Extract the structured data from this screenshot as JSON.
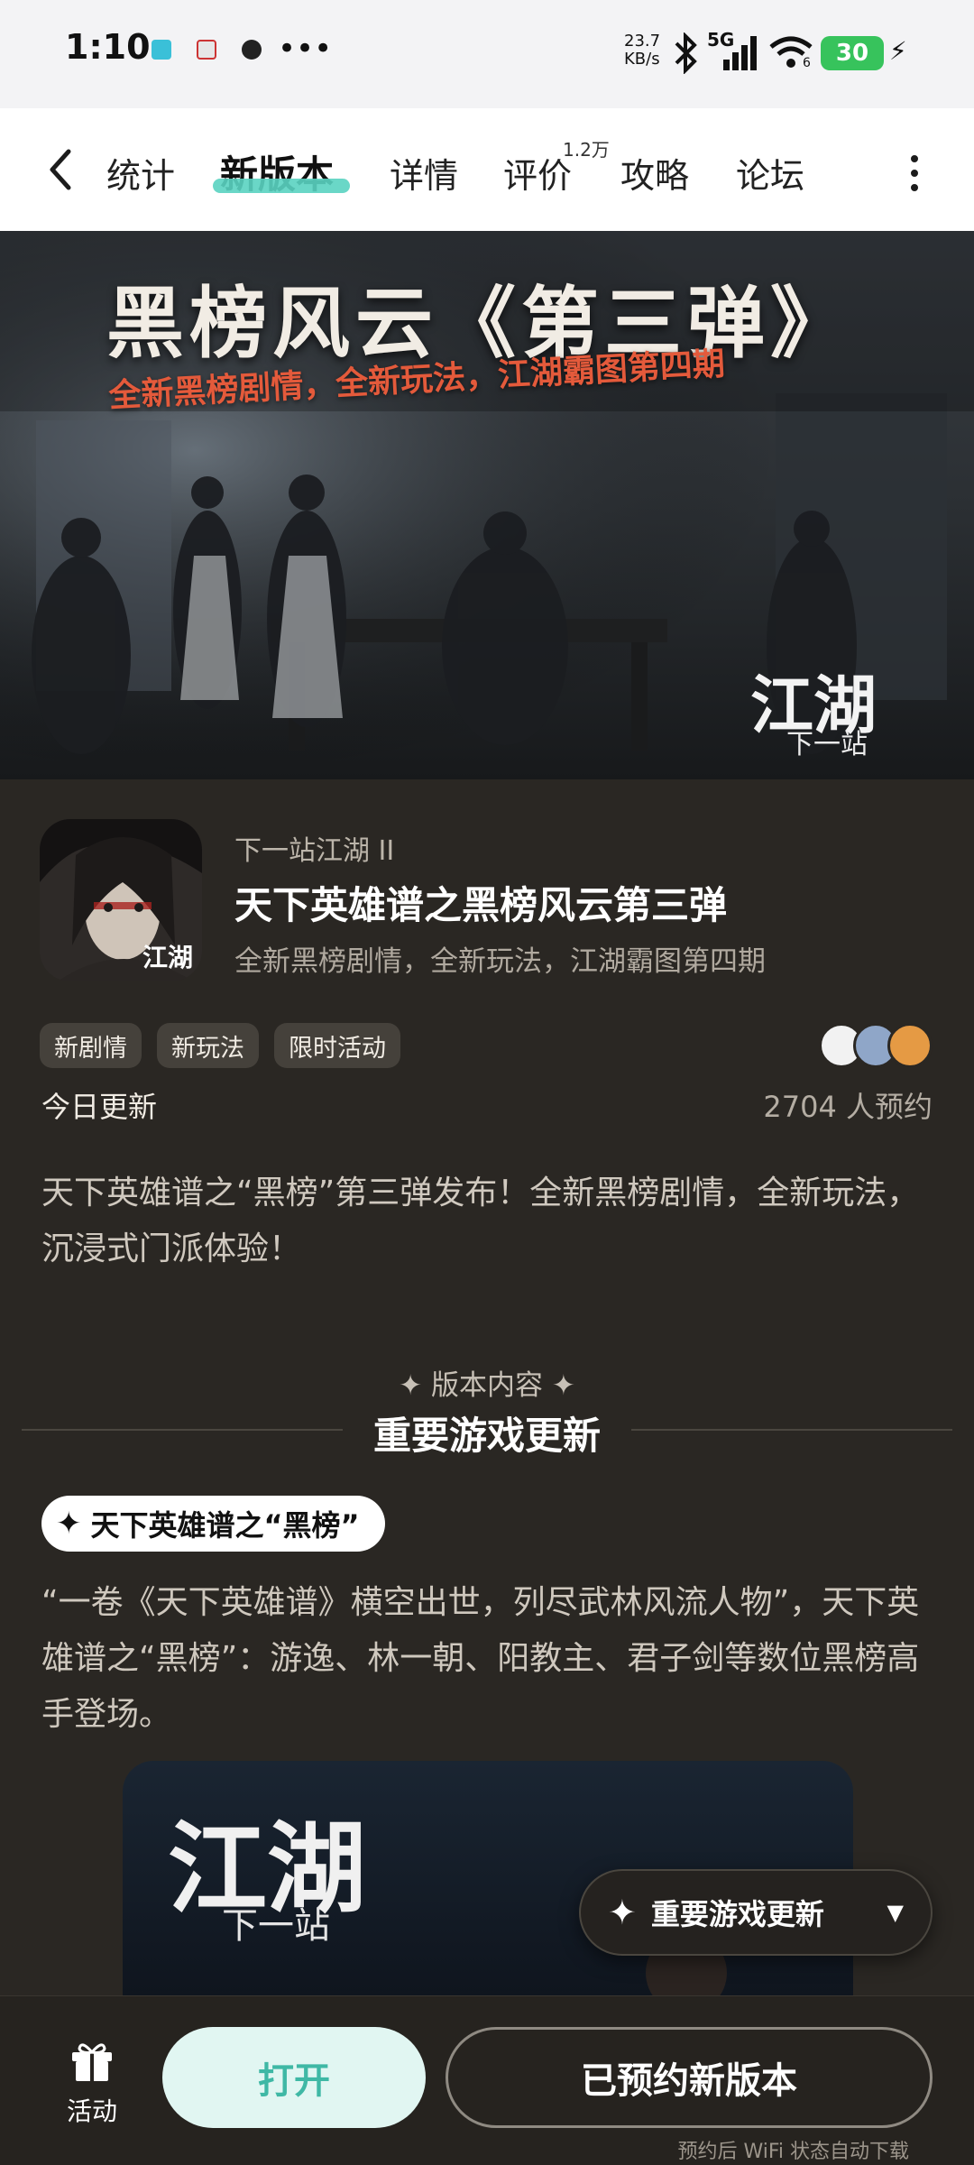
{
  "status_bar": {
    "time": "1:10",
    "more": "•••",
    "net_speed_value": "23.7",
    "net_speed_unit": "KB/s",
    "network": "5G",
    "wifi_level": "6",
    "battery": "30"
  },
  "nav": {
    "tabs": [
      "统计",
      "新版本",
      "详情",
      "评价",
      "攻略",
      "论坛"
    ],
    "active_tab": "新版本",
    "review_badge": "1.2万"
  },
  "banner": {
    "title": "黑榜风云《第三弹》",
    "subtitle": "全新黑榜剧情，全新玩法，江湖霸图第四期",
    "logo_main": "江湖",
    "logo_sub": "下一站"
  },
  "app": {
    "icon_text": "江湖",
    "developer": "下一站江湖 II",
    "title": "天下英雄谱之黑榜风云第三弹",
    "desc": "全新黑榜剧情，全新玩法，江湖霸图第四期",
    "tags": [
      "新剧情",
      "新玩法",
      "限时活动"
    ],
    "update_status": "今日更新",
    "reserve_count": "2704 人预约"
  },
  "intro_text": "天下英雄谱之“黑榜”第三弹发布！全新黑榜剧情，全新玩法，沉浸式门派体验！",
  "section": {
    "kicker": "✦ 版本内容 ✦",
    "title": "重要游戏更新",
    "heading_pill": "天下英雄谱之“黑榜”",
    "body": "“一卷《天下英雄谱》横空出世，列尽武林风流人物”，天下英雄谱之“黑榜”：游逸、林一朝、阳教主、君子剑等数位黑榜高手登场。"
  },
  "floating": {
    "label": "重要游戏更新"
  },
  "bottom": {
    "activity_label": "活动",
    "open_label": "打开",
    "reserved_label": "已预约新版本",
    "footnote": "预约后 WiFi 状态自动下载"
  },
  "colors": {
    "accent_teal": "#5ad3c1",
    "background": "#2a2723",
    "banner_subtitle_red": "#e45a3b"
  }
}
